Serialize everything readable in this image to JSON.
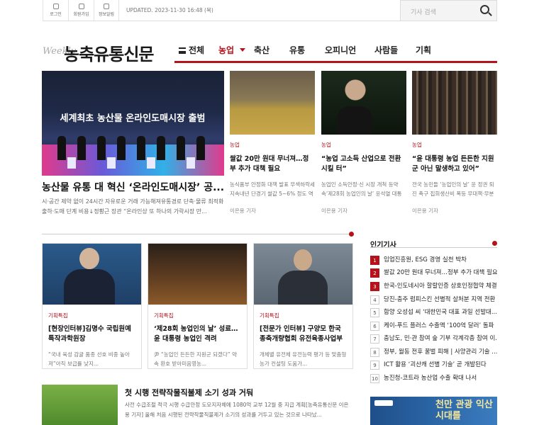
{
  "topbar": {
    "login": "로그인",
    "signup": "회원가입",
    "rss": "정보알림",
    "updated": "UPDATED. 2023-11-30 16:48 (목)",
    "search_placeholder": "기사 검색"
  },
  "logo": {
    "weekly": "Weekly",
    "name": "농축유통신문"
  },
  "nav": {
    "all": "전체",
    "items": [
      "농업",
      "축산",
      "유통",
      "오피니언",
      "사람들",
      "기획"
    ]
  },
  "hero": {
    "banner": "세계최초 농산물 온라인도매시장 출범",
    "title": "농산물 유통 대 혁신 ‘온라인도매시장’ 공...",
    "desc": "시·공간 제약 없이 24시간 자유로운 거래 가능해져유통경로 단축·물류 최적화 출하·도매 단계 비용↓정황근 장관 “온라인상 또 하나의 가락시장 만..."
  },
  "cards": [
    {
      "cat": "농업",
      "title": "쌀값 20만 원대 무너져…정부 추가 대책 필요",
      "desc": "농식품부 안정화 대책 발표 무색하락세 지속내년 단경기 쌀값 5~6% 정도 역계절진폭 전망현...",
      "author": "이은용 기자"
    },
    {
      "cat": "농업",
      "title": "“농업 고소득 산업으로 전환 시킬 터”",
      "desc": "농업인 소득안정·신 시장 개척 등약속‘제28회 농업인의 날’ 윤석열 대통령 참석[농축유통신문 이은...",
      "author": "이은용 기자"
    },
    {
      "cat": "농업",
      "title": "“윤 대통령 농업 든든한 지원군 아닌 말생하고 있어”",
      "desc": "전국 농민들 ‘농업인의 날’ 윤 정권 퇴진 촉구 집회생산비 폭등 무대책·무분별한 농산물 수입 등 비...",
      "author": "이은용 기자"
    }
  ],
  "row2": [
    {
      "cat": "기획특집",
      "title": "[현장인터뷰]김명수 국립원예특작과학원장",
      "desc": "“국내 육성 감귤 품종 선호 비중 높아져”아직 보급률 낮지..."
    },
    {
      "cat": "기획특집",
      "title": "‘제28회 농업인의 날’ 성료…윤 대통령 농업인 격려",
      "desc": "尹 “농업인 든든한 지원군 되겠다” 약속 환호 받아미음영농..."
    },
    {
      "cat": "기획특집",
      "title": "[전문가 인터뷰] 구양모 한국종축개량협회 유전육종사업부장",
      "desc": "개체별 유전체 유전능력 평가 등 맞춤형 농가 컨설팅 도움가..."
    }
  ],
  "popular": {
    "heading": "인기기사",
    "items": [
      "임업진흥원, ESG 경영 실천 박차",
      "쌀값 20만 원대 무너져…정부 추가 대책 필요",
      "한국-인도네시아 할랄인증 상호인정협약 체결",
      "당진-충주 럼피스킨 선별적 살처분 지역 전환",
      "함양 오성섭 씨 ‘대한민국 대표 과일 선발대...",
      "케이-푸드 플러스 수출액 ‘100억 달러’ 돌파",
      "충남도, 민·관 참여 숲 기부 각계각층 참여 이...",
      "정부, 월동 전후 꿀벌 피해 | 사양관리 기술 ...",
      "ICT 활용 ‘괴산캐 선별 기술’ 곧 개발된다",
      "농진청-코트라 농산업 수출 확대 나서"
    ]
  },
  "bottom": {
    "title": "첫 시행 전략작물직불제 소기 성과 거둬",
    "desc": "사전 수급조절 적극 시행 수급안정 도모지자체에 1080억 교부 12월 중 지급 계획[농축유통신문 이은용 기자] 올해 처음 시행된 전략작물직불제가 소기의 성과를 거두고 있는 것으로 나타났..."
  },
  "ad": {
    "text": "천만 관광 익산시대를"
  },
  "colors": {
    "accent": "#b5121b"
  }
}
